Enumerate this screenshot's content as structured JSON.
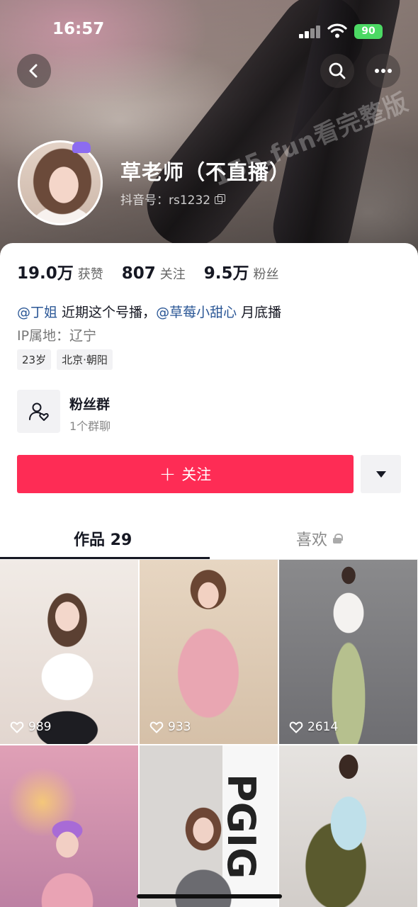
{
  "status_bar": {
    "time": "16:57",
    "battery": "90"
  },
  "cover": {
    "watermark": "155.fun看完整版"
  },
  "profile": {
    "name": "草老师（不直播）",
    "douyin_id": "抖音号：rs1232"
  },
  "stats": [
    {
      "value": "19.0万",
      "label": "获赞"
    },
    {
      "value": "807",
      "label": "关注"
    },
    {
      "value": "9.5万",
      "label": "粉丝"
    }
  ],
  "bio": {
    "mention1": "@丁姐",
    "text1": " 近期这个号播，",
    "mention2": "@草莓小甜心",
    "text2": " 月底播"
  },
  "ip_location": "IP属地：辽宁",
  "tags": [
    "23岁",
    "北京·朝阳"
  ],
  "fan_group": {
    "title": "粉丝群",
    "subtitle": "1个群聊"
  },
  "actions": {
    "follow_plus": "+",
    "follow_label": "关注"
  },
  "tabs": {
    "works": "作品 29",
    "likes": "喜欢"
  },
  "videos": [
    {
      "likes": "989"
    },
    {
      "likes": "933"
    },
    {
      "likes": "2614"
    },
    {
      "likes": ""
    },
    {
      "likes": "",
      "overlay_text": "PGIG"
    },
    {
      "likes": ""
    }
  ],
  "colors": {
    "accent": "#fe2c55",
    "mention": "#2b5796",
    "battery": "#4cd964"
  },
  "icons": {
    "back": "chevron-left-icon",
    "search": "search-icon",
    "more": "more-dots-icon",
    "fan_group": "group-heart-icon",
    "dropdown": "triangle-down-icon",
    "lock": "lock-icon",
    "like": "heart-outline-icon"
  }
}
